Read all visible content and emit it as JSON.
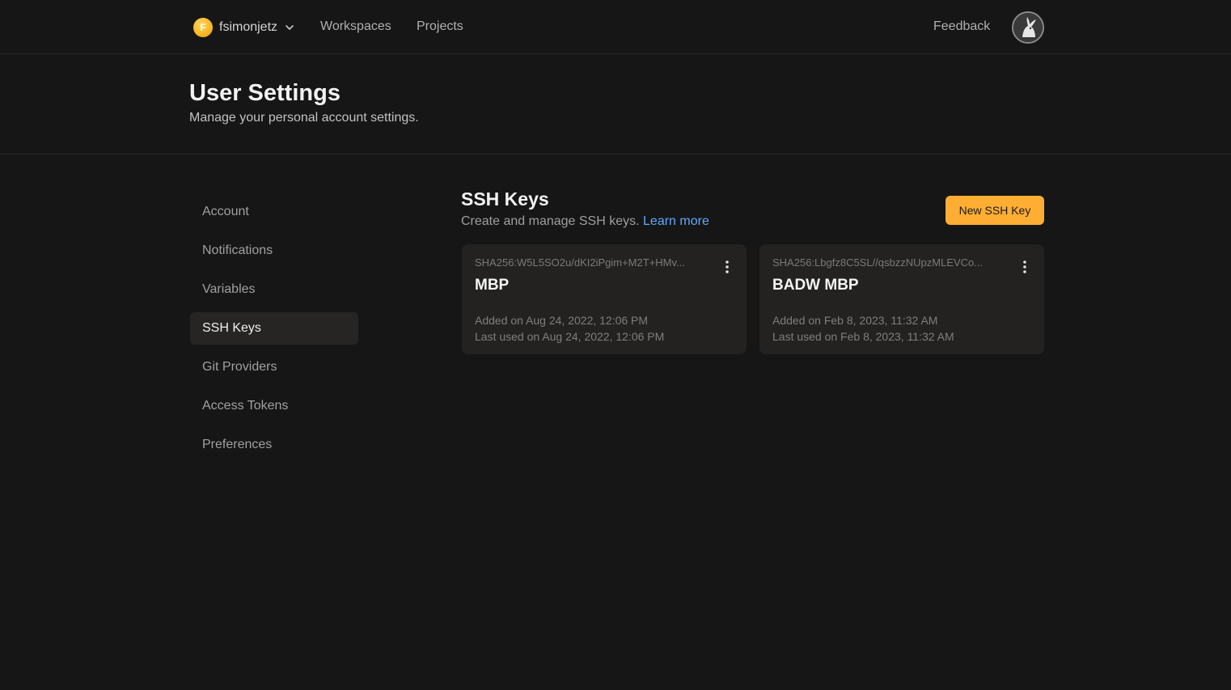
{
  "topbar": {
    "org_initial": "F",
    "org_name": "fsimonjetz",
    "nav": [
      "Workspaces",
      "Projects"
    ],
    "feedback": "Feedback",
    "avatar_icon": "user-avatar-icon"
  },
  "header": {
    "title": "User Settings",
    "subtitle": "Manage your personal account settings."
  },
  "sidebar": {
    "items": [
      {
        "label": "Account",
        "active": false
      },
      {
        "label": "Notifications",
        "active": false
      },
      {
        "label": "Variables",
        "active": false
      },
      {
        "label": "SSH Keys",
        "active": true
      },
      {
        "label": "Git Providers",
        "active": false
      },
      {
        "label": "Access Tokens",
        "active": false
      },
      {
        "label": "Preferences",
        "active": false
      }
    ]
  },
  "main": {
    "title": "SSH Keys",
    "description": "Create and manage SSH keys.",
    "learn_more": "Learn more",
    "new_button": "New SSH Key",
    "keys": [
      {
        "fingerprint": "SHA256:W5L5SO2u/dKI2iPgim+M2T+HMv...",
        "name": "MBP",
        "added": "Added on Aug 24, 2022, 12:06 PM",
        "last_used": "Last used on Aug 24, 2022, 12:06 PM"
      },
      {
        "fingerprint": "SHA256:Lbgfz8C5SL//qsbzzNUpzMLEVCo...",
        "name": "BADW MBP",
        "added": "Added on Feb 8, 2023, 11:32 AM",
        "last_used": "Last used on Feb 8, 2023, 11:32 AM"
      }
    ]
  },
  "colors": {
    "background": "#161616",
    "accent": "#ffae33",
    "link": "#5fa8ff",
    "card": "#232220"
  }
}
